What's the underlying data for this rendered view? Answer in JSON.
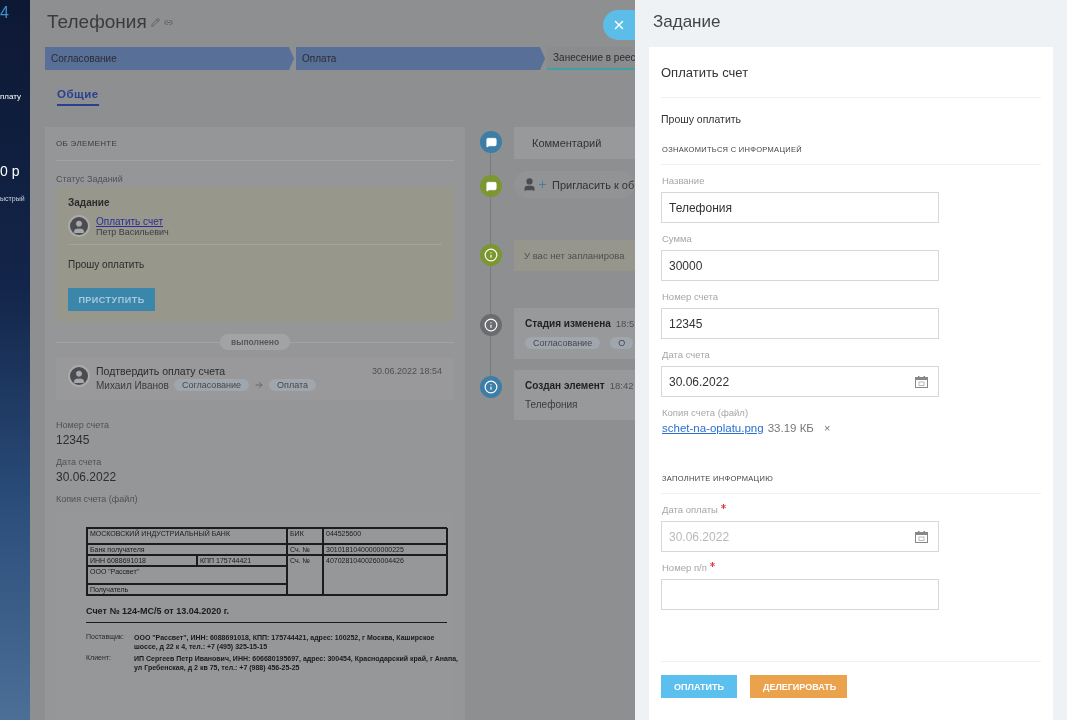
{
  "background": {
    "fragments": [
      "4",
      "плату",
      "0 р",
      "ыстрый"
    ]
  },
  "element": {
    "title": "Телефония",
    "stages": [
      {
        "label": "Согласование",
        "completed": true
      },
      {
        "label": "Оплата",
        "completed": true
      },
      {
        "label": "Занесение в реес",
        "completed": false
      }
    ],
    "tabs": [
      {
        "label": "Общие",
        "selected": true
      }
    ],
    "about": {
      "heading": "ОБ ЭЛЕМЕНТЕ",
      "status_label": "Статус Заданий",
      "task": {
        "title": "Задание",
        "link": "Оплатить счет",
        "assignee": "Петр Васильевич",
        "message": "Прошу оплатить",
        "button": "ПРИСТУПИТЬ"
      },
      "divider_label": "выполнено",
      "completed": [
        {
          "title": "Подтвердить оплату счета",
          "person": "Михаил Иванов",
          "from": "Согласование",
          "to": "Оплата",
          "time": "30.06.2022 18:54"
        }
      ],
      "fields": [
        {
          "label": "Номер счета",
          "value": "12345"
        },
        {
          "label": "Дата счета",
          "value": "30.06.2022"
        }
      ],
      "file_label": "Копия счета (файл)"
    },
    "invoice": {
      "bank": "МОСКОВСКИЙ ИНДУСТРИАЛЬНЫЙ БАНК",
      "bank_caption": "Банк получателя",
      "bik_label": "БИК",
      "bik": "044525600",
      "corr_label": "Сч. №",
      "corr": "30101810400000000225",
      "inn": "ИНН 6088691018",
      "kpp": "КПП 175744421",
      "account_label": "Сч. №",
      "account": "40702810400260004426",
      "recipient": "ООО \"Рассвет\"",
      "recipient_caption": "Получатель",
      "title": "Счет № 124-МС/5 от 13.04.2020 г.",
      "parties": [
        {
          "label": "Поставщик:",
          "text": "ООО \"Рассвет\", ИНН: 6088691018, КПП: 175744421, адрес: 100252, г Москва, Каширское шоссе, д 22 к 4, тел.: +7 (495) 325-15-15"
        },
        {
          "label": "Клиент:",
          "text": "ИП Сергеев Петр Иванович, ИНН: 606680195697, адрес: 300454, Краснодарский край, г Анапа, ул Гребенская, д 2 кв 75, тел.: +7 (988) 456-25-25"
        }
      ]
    },
    "timeline": [
      {
        "kind": "comment",
        "color": "#3d7ea6",
        "text": "Комментарий"
      },
      {
        "kind": "invite",
        "color": "#7c9630",
        "text": "Пригласить к об"
      },
      {
        "kind": "notice",
        "color": "#7c9630",
        "text": "У вас нет запланирова"
      },
      {
        "kind": "event",
        "color": "#6a6c6f",
        "title": "Стадия изменена",
        "time": "18:5",
        "from": "Согласование",
        "to": "О"
      },
      {
        "kind": "event",
        "color": "#3d7ea6",
        "title": "Создан элемент",
        "time": "18:42",
        "body": "Телефония"
      }
    ]
  },
  "task_panel": {
    "title": "Задание",
    "task_title": "Оплатить счет",
    "message": "Прошу оплатить",
    "sections": [
      {
        "heading": "ОЗНАКОМИТЬСЯ С ИНФОРМАЦИЕЙ",
        "fields": [
          {
            "kind": "text",
            "label": "Название",
            "value": "Телефония",
            "required": false
          },
          {
            "kind": "text",
            "label": "Сумма",
            "value": "30000",
            "required": false
          },
          {
            "kind": "text",
            "label": "Номер счета",
            "value": "12345",
            "required": false
          },
          {
            "kind": "date",
            "label": "Дата счета",
            "value": "30.06.2022",
            "required": false
          },
          {
            "kind": "file",
            "label": "Копия счета (файл)",
            "file": "schet-na-oplatu.png",
            "size": "33.19 КБ",
            "remove": "×",
            "required": false
          }
        ]
      },
      {
        "heading": "ЗАПОЛНИТЕ ИНФОРМАЦИЮ",
        "fields": [
          {
            "kind": "date",
            "label": "Дата оплаты",
            "placeholder": "30.06.2022",
            "required": true
          },
          {
            "kind": "text",
            "label": "Номер п/п",
            "required": true
          }
        ]
      }
    ],
    "buttons": [
      {
        "label": "ОПЛАТИТЬ",
        "kind": "primary"
      },
      {
        "label": "ДЕЛЕГИРОВАТЬ",
        "kind": "secondary"
      }
    ]
  }
}
